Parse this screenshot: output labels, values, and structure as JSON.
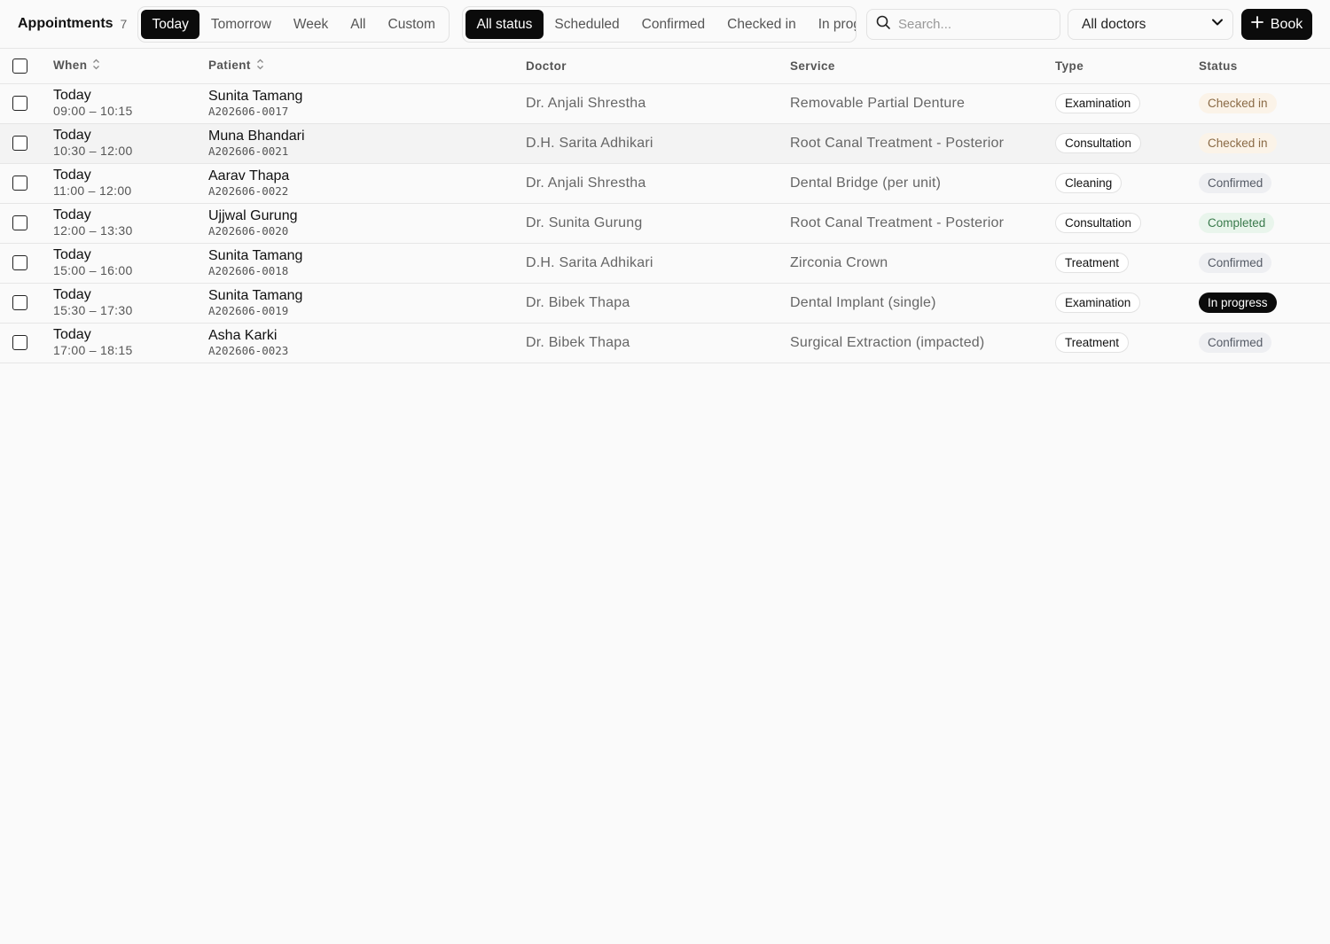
{
  "header": {
    "title": "Appointments",
    "count": "7",
    "range_tabs": [
      {
        "label": "Today",
        "active": true
      },
      {
        "label": "Tomorrow",
        "active": false
      },
      {
        "label": "Week",
        "active": false
      },
      {
        "label": "All",
        "active": false
      },
      {
        "label": "Custom",
        "active": false
      }
    ],
    "status_tabs": [
      {
        "label": "All status",
        "active": true
      },
      {
        "label": "Scheduled",
        "active": false
      },
      {
        "label": "Confirmed",
        "active": false
      },
      {
        "label": "Checked in",
        "active": false
      },
      {
        "label": "In progress",
        "active": false
      }
    ],
    "search_placeholder": "Search...",
    "doctor_filter": "All doctors",
    "book_label": "Book"
  },
  "table": {
    "columns": {
      "when": "When",
      "patient": "Patient",
      "doctor": "Doctor",
      "service": "Service",
      "type": "Type",
      "status": "Status"
    },
    "rows": [
      {
        "day": "Today",
        "time": "09:00 – 10:15",
        "patient": "Sunita Tamang",
        "patient_id": "A202606-0017",
        "doctor": "Dr. Anjali Shrestha",
        "service": "Removable Partial Denture",
        "type": "Examination",
        "status": "Checked in",
        "status_kind": "checked"
      },
      {
        "day": "Today",
        "time": "10:30 – 12:00",
        "patient": "Muna Bhandari",
        "patient_id": "A202606-0021",
        "doctor": "D.H. Sarita Adhikari",
        "service": "Root Canal Treatment - Posterior",
        "type": "Consultation",
        "status": "Checked in",
        "status_kind": "checked"
      },
      {
        "day": "Today",
        "time": "11:00 – 12:00",
        "patient": "Aarav Thapa",
        "patient_id": "A202606-0022",
        "doctor": "Dr. Anjali Shrestha",
        "service": "Dental Bridge (per unit)",
        "type": "Cleaning",
        "status": "Confirmed",
        "status_kind": "confirmed"
      },
      {
        "day": "Today",
        "time": "12:00 – 13:30",
        "patient": "Ujjwal Gurung",
        "patient_id": "A202606-0020",
        "doctor": "Dr. Sunita Gurung",
        "service": "Root Canal Treatment - Posterior",
        "type": "Consultation",
        "status": "Completed",
        "status_kind": "completed"
      },
      {
        "day": "Today",
        "time": "15:00 – 16:00",
        "patient": "Sunita Tamang",
        "patient_id": "A202606-0018",
        "doctor": "D.H. Sarita Adhikari",
        "service": "Zirconia Crown",
        "type": "Treatment",
        "status": "Confirmed",
        "status_kind": "confirmed"
      },
      {
        "day": "Today",
        "time": "15:30 – 17:30",
        "patient": "Sunita Tamang",
        "patient_id": "A202606-0019",
        "doctor": "Dr. Bibek Thapa",
        "service": "Dental Implant (single)",
        "type": "Examination",
        "status": "In progress",
        "status_kind": "progress"
      },
      {
        "day": "Today",
        "time": "17:00 – 18:15",
        "patient": "Asha Karki",
        "patient_id": "A202606-0023",
        "doctor": "Dr. Bibek Thapa",
        "service": "Surgical Extraction (impacted)",
        "type": "Treatment",
        "status": "Confirmed",
        "status_kind": "confirmed"
      }
    ]
  }
}
